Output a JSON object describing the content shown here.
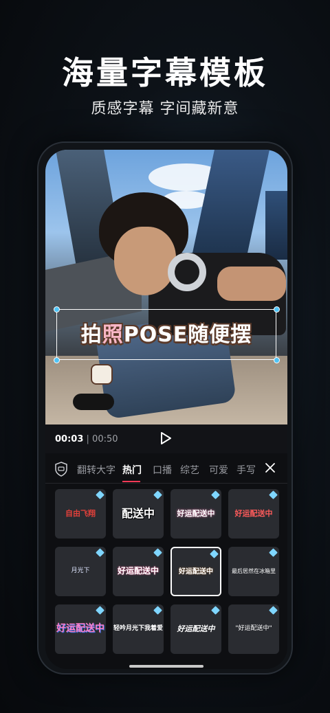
{
  "headline": "海量字幕模板",
  "subline": "质感字幕 字间藏新意",
  "preview": {
    "sticker_pre": "拍",
    "sticker_highlight": "照",
    "sticker_post": "POSE随便摆"
  },
  "playbar": {
    "current": "00:03",
    "separator": " | ",
    "total": "00:50"
  },
  "tabs": [
    {
      "label": "翻转大字"
    },
    {
      "label": "热门"
    },
    {
      "label": "口播"
    },
    {
      "label": "综艺"
    },
    {
      "label": "可爱"
    },
    {
      "label": "手写"
    }
  ],
  "active_tab": "热门",
  "templates": [
    {
      "text": "自由飞翔",
      "color": "#e0403a"
    },
    {
      "text": "配送中",
      "color": "#ffffff"
    },
    {
      "text": "好运配送中",
      "color": "#ffffff"
    },
    {
      "text": "好运配送中",
      "color": "#ff5b5b"
    },
    {
      "text": "月光下",
      "color": "#dfe6ff"
    },
    {
      "text": "好运配送中",
      "color": "#ffffff"
    },
    {
      "text": "好运配送中",
      "color": "#ffffff"
    },
    {
      "text": "最后居然在冰箱里",
      "color": "#ffffff"
    },
    {
      "text": "好运配送中",
      "color": "#ff7fc8"
    },
    {
      "text": "轻吟月光下我着爱",
      "color": "#ffffff"
    },
    {
      "text": "好运配送中",
      "color": "#ffffff"
    },
    {
      "text": "\"好运配送中\"",
      "color": "#ffffff"
    }
  ],
  "accent": "#ff3a56",
  "handle_color": "#4fc4f7",
  "vip_color": "#7fd6ff"
}
